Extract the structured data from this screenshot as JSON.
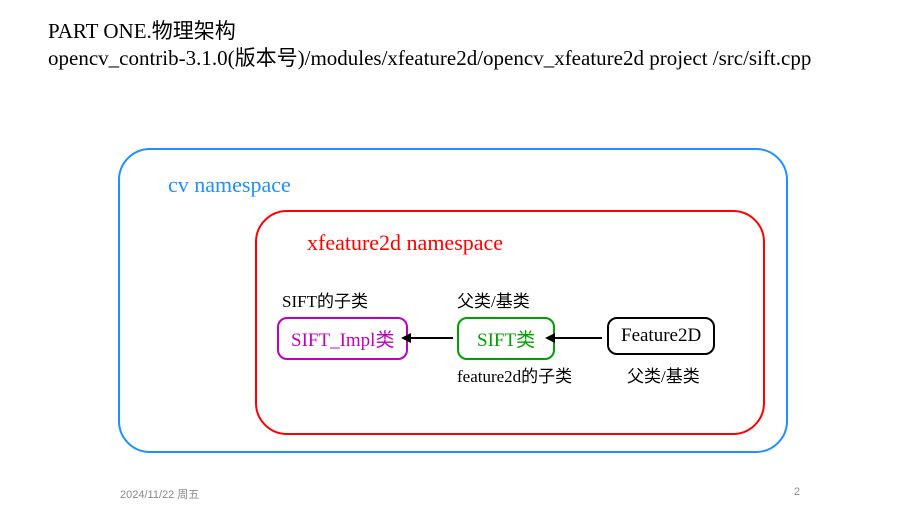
{
  "header": {
    "line1": "PART ONE.物理架构",
    "line2": "opencv_contrib-3.1.0(版本号)/modules/xfeature2d/opencv_xfeature2d project /src/sift.cpp"
  },
  "footer": {
    "date": "2024/11/22 周五",
    "page": "2"
  },
  "diagram": {
    "outer_ns_label": "cv namespace",
    "inner_ns_label": "xfeature2d namespace",
    "boxes": {
      "sift_impl": "SIFT_Impl类",
      "sift": "SIFT类",
      "feature2d": "Feature2D"
    },
    "annotations": {
      "sift_subclass": "SIFT的子类",
      "parent1": "父类/基类",
      "feature2d_subclass": "feature2d的子类",
      "parent2": "父类/基类"
    },
    "relationships": [
      {
        "from": "SIFT类",
        "to": "SIFT_Impl类",
        "meaning": "SIFT_Impl类 is subclass of SIFT类"
      },
      {
        "from": "Feature2D",
        "to": "SIFT类",
        "meaning": "SIFT类 is subclass of Feature2D"
      }
    ]
  }
}
